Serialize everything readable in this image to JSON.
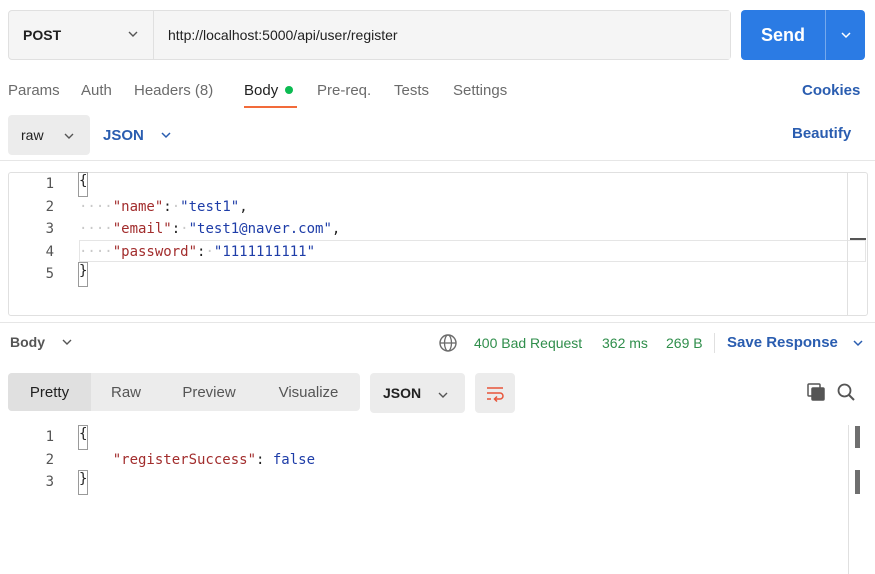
{
  "request": {
    "method": "POST",
    "url": "http://localhost:5000/api/user/register",
    "send_label": "Send"
  },
  "tabs": {
    "params": "Params",
    "auth": "Auth",
    "headers": "Headers (8)",
    "body": "Body",
    "prereq": "Pre-req.",
    "tests": "Tests",
    "settings": "Settings",
    "cookies": "Cookies",
    "active": "Body"
  },
  "body_options": {
    "mode": "raw",
    "language": "JSON",
    "beautify": "Beautify"
  },
  "request_editor": {
    "line_numbers": [
      "1",
      "2",
      "3",
      "4",
      "5"
    ],
    "open_brace": "{",
    "close_brace": "}",
    "fields": [
      {
        "key": "\"name\"",
        "value": "\"test1\"",
        "trail": ","
      },
      {
        "key": "\"email\"",
        "value": "\"test1@naver.com\"",
        "trail": ","
      },
      {
        "key": "\"password\"",
        "value": "\"1111111111\"",
        "trail": ""
      }
    ]
  },
  "response_bar": {
    "section_label": "Body",
    "status": "400 Bad Request",
    "time": "362 ms",
    "size": "269 B",
    "save_label": "Save Response"
  },
  "response_view": {
    "tabs": [
      "Pretty",
      "Raw",
      "Preview",
      "Visualize"
    ],
    "active_tab": "Pretty",
    "language": "JSON"
  },
  "response_editor": {
    "line_numbers": [
      "1",
      "2",
      "3"
    ],
    "open_brace": "{",
    "close_brace": "}",
    "key": "\"registerSuccess\"",
    "value": "false"
  },
  "colors": {
    "accent_send": "#2b7be4",
    "active_tab_underline": "#f26b3a",
    "body_dot": "#0cbb52",
    "link": "#2a5db0",
    "status_ok_text": "#2f8e4b"
  },
  "icons": [
    "chevron-down-icon",
    "globe-icon",
    "wrap-lines-icon",
    "copy-icon",
    "search-icon"
  ]
}
